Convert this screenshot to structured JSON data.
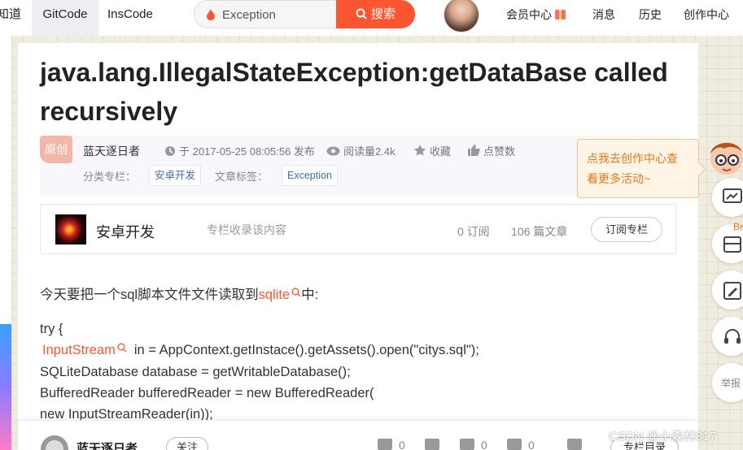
{
  "nav": {
    "items": [
      "知道",
      "GitCode",
      "InsCode"
    ],
    "search_value": "Exception",
    "search_button": "搜索",
    "right_items": [
      "会员中心",
      "消息",
      "历史",
      "创作中心"
    ]
  },
  "article": {
    "title": "java.lang.IllegalStateException:getDataBase called recursively",
    "original_badge": "原创",
    "author": "蓝天逐日者",
    "date": "于 2017-05-25 08:05:56 发布",
    "reads": "阅读量2.4k",
    "favorite": "收藏",
    "likes": "点赞数",
    "category_label": "分类专栏：",
    "category": "安卓开发",
    "tags_label": "文章标签：",
    "tag": "Exception"
  },
  "popup": {
    "line1": "点我去创作中心查",
    "line2": "看更多活动~"
  },
  "column": {
    "name": "安卓开发",
    "desc": "专栏收录该内容",
    "subscribers": "0 订阅",
    "articles": "106 篇文章",
    "button": "订阅专栏"
  },
  "content": {
    "intro_before": "今天要把一个sql脚本文件文件读取到",
    "intro_link": "sqlite",
    "intro_after": "中:",
    "code1": "try {",
    "code2_link": "InputStream",
    "code2_rest": "in = AppContext.getInstace().getAssets().open(\"citys.sql\");",
    "code3": "SQLiteDatabase database = getWritableDatabase();",
    "code4": "BufferedReader bufferedReader = new BufferedReader(",
    "code5": "new InputStreamReader(in));"
  },
  "bottom": {
    "author": "蓝天逐日者",
    "follow": "关注",
    "likes": "0",
    "comments": "0",
    "favorites": "0",
    "shares": "0",
    "directory": "专栏目录"
  },
  "sidebar": {
    "label_be": "Be",
    "label_report": "举报"
  },
  "watermark": "CSDN @小森林817",
  "colors": {
    "accent": "#fc5531",
    "tag_text": "#3e6ca9",
    "popup_text": "#e9761c"
  }
}
